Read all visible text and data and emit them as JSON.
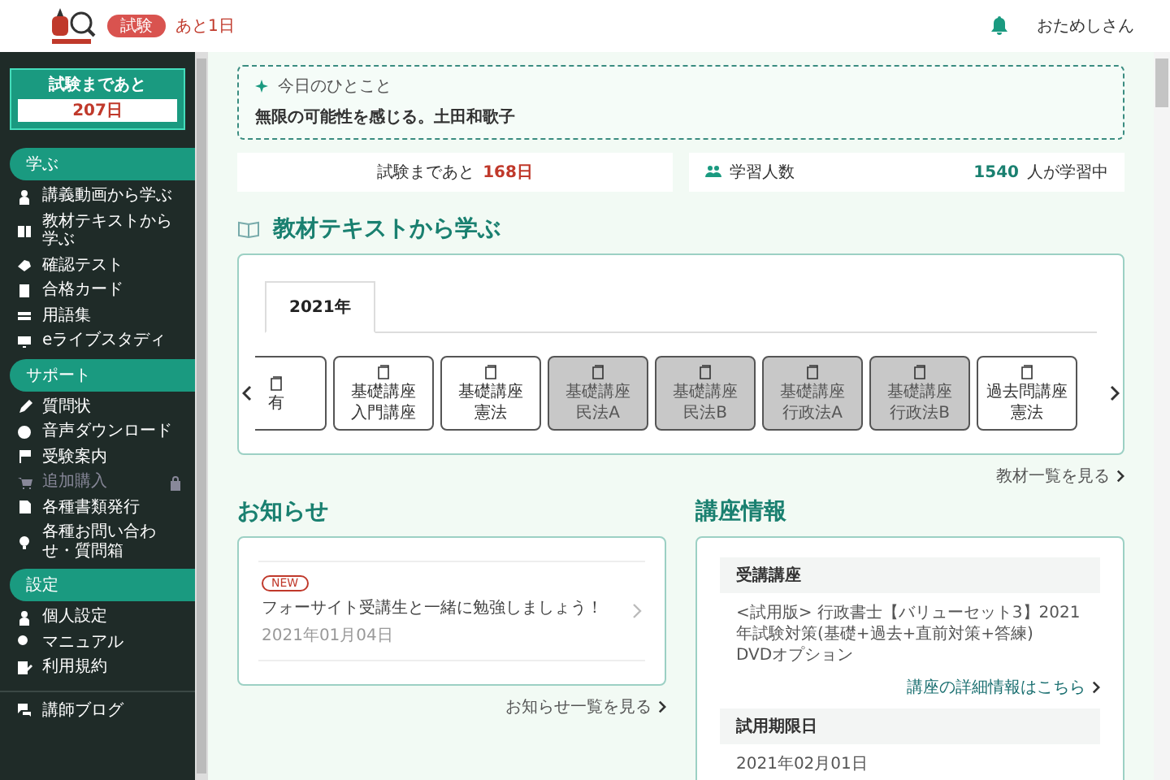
{
  "header": {
    "badge": "試験",
    "countdown": "あと1日",
    "user": "おためしさん"
  },
  "sidebar": {
    "countdown": {
      "label": "試験まであと",
      "days": "207日"
    },
    "sections": [
      {
        "title": "学ぶ",
        "items": [
          {
            "label": "講義動画から学ぶ",
            "disabled": false
          },
          {
            "label": "教材テキストから学ぶ",
            "disabled": false
          },
          {
            "label": "確認テスト",
            "disabled": false
          },
          {
            "label": "合格カード",
            "disabled": false
          },
          {
            "label": "用語集",
            "disabled": false
          },
          {
            "label": "eライブスタディ",
            "disabled": false
          }
        ]
      },
      {
        "title": "サポート",
        "items": [
          {
            "label": "質問状",
            "disabled": false
          },
          {
            "label": "音声ダウンロード",
            "disabled": false
          },
          {
            "label": "受験案内",
            "disabled": false
          },
          {
            "label": "追加購入",
            "disabled": true
          },
          {
            "label": "各種書類発行",
            "disabled": false
          },
          {
            "label": "各種お問い合わせ・質問箱",
            "disabled": false
          }
        ]
      },
      {
        "title": "設定",
        "items": [
          {
            "label": "個人設定",
            "disabled": false
          },
          {
            "label": "マニュアル",
            "disabled": false
          },
          {
            "label": "利用規約",
            "disabled": false
          }
        ]
      }
    ],
    "footer_items": [
      {
        "label": "講師ブログ"
      }
    ]
  },
  "quote": {
    "title": "今日のひとこと",
    "text": "無限の可能性を感じる。土田和歌子"
  },
  "stats": {
    "countdown_label": "試験まであと",
    "countdown_days": "168日",
    "learners_label": "学習人数",
    "learners_count": "1540",
    "learners_suffix": "人が学習中"
  },
  "materials": {
    "title": "教材テキストから学ぶ",
    "tabs": [
      {
        "label": "2021年",
        "selected": true
      }
    ],
    "cards": [
      {
        "subject": "有",
        "locked": false
      },
      {
        "course": "基礎講座",
        "subject": "入門講座",
        "locked": false
      },
      {
        "course": "基礎講座",
        "subject": "憲法",
        "locked": false
      },
      {
        "course": "基礎講座",
        "subject": "民法A",
        "locked": true
      },
      {
        "course": "基礎講座",
        "subject": "民法B",
        "locked": true
      },
      {
        "course": "基礎講座",
        "subject": "行政法A",
        "locked": true
      },
      {
        "course": "基礎講座",
        "subject": "行政法B",
        "locked": true
      },
      {
        "course": "過去問講座",
        "subject": "憲法",
        "locked": false
      }
    ],
    "more_link": "教材一覧を見る"
  },
  "notices": {
    "title": "お知らせ",
    "items": [
      {
        "badge": "NEW",
        "title": "フォーサイト受講生と一緒に勉強しましょう！",
        "date": "2021年01月04日"
      }
    ],
    "more_link": "お知らせ一覧を見る"
  },
  "course": {
    "title": "講座情報",
    "sections": [
      {
        "heading": "受講講座",
        "text": "<試用版> 行政書士【バリューセット3】2021年試験対策(基礎+過去+直前対策+答練)　DVDオプション",
        "link": "講座の詳細情報はこちら"
      },
      {
        "heading": "試用期限日",
        "text": "2021年02月01日"
      }
    ]
  }
}
